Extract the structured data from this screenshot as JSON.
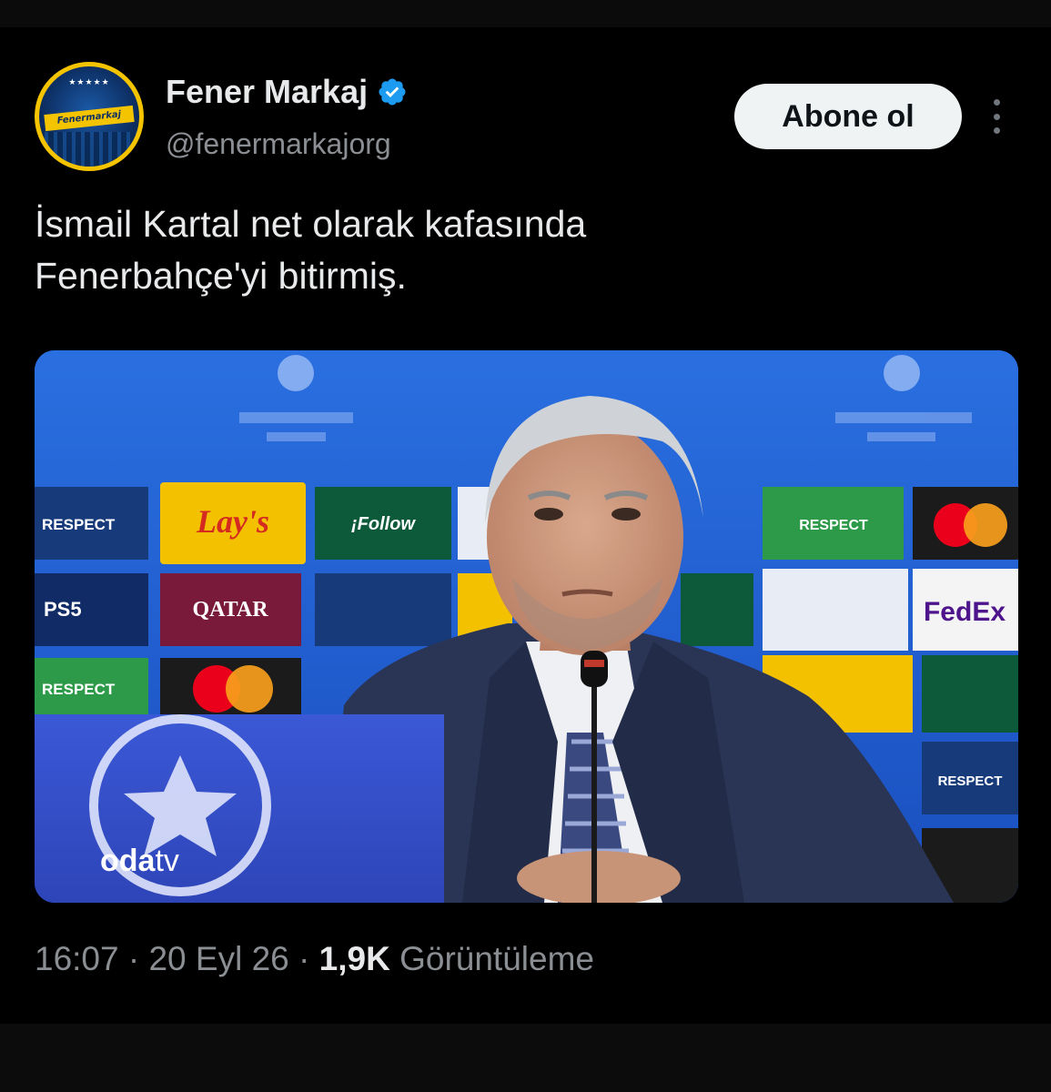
{
  "account": {
    "display_name": "Fener Markaj",
    "handle": "@fenermarkajorg",
    "verified": true,
    "avatar_text": "Fenermarkaj",
    "avatar_stars": "★★★★★"
  },
  "actions": {
    "follow_label": "Abone ol",
    "more_icon": "more-vertical-icon"
  },
  "tweet": {
    "text_lines": [
      "İsmail Kartal net olarak kafasında",
      "Fenerbahçe'yi bitirmiş."
    ]
  },
  "media": {
    "watermark_bold": "oda",
    "watermark_light": "tv",
    "board_labels": [
      "RESPECT",
      "Lay's",
      "¡Follow",
      "QATAR",
      "FedEx",
      "RESPECT",
      "RESPECT",
      "RESPECT"
    ]
  },
  "meta": {
    "time": "16:07",
    "separator": "·",
    "date": "20 Eyl 26",
    "views_count": "1,9K",
    "views_label": "Görüntüleme"
  },
  "colors": {
    "background": "#000000",
    "text_primary": "#e7e9ea",
    "text_secondary": "#8b8f94",
    "verified_blue": "#1d9bf0",
    "avatar_ring": "#f5c400"
  }
}
